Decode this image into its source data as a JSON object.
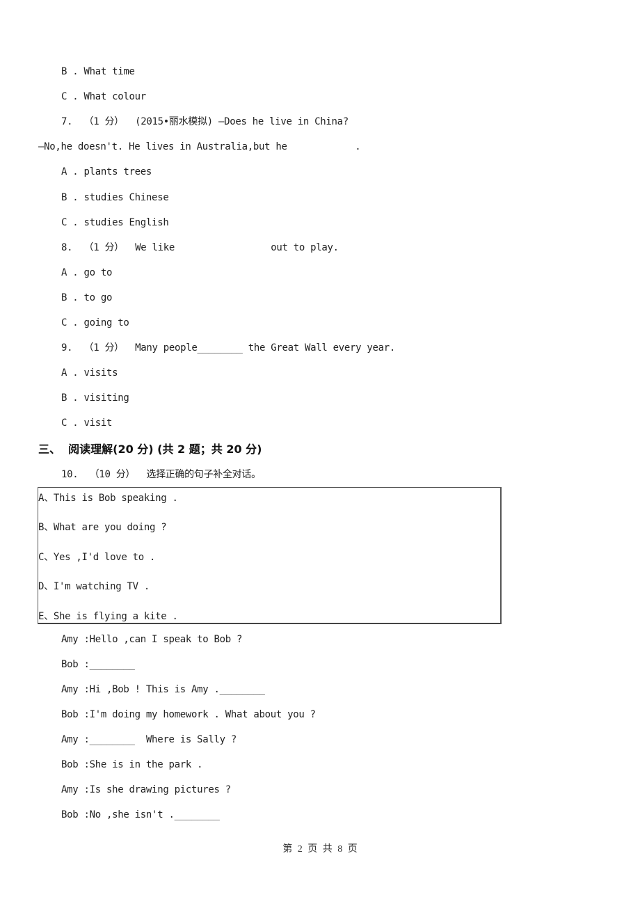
{
  "page": {
    "lines": [
      {
        "id": "q6-option-b",
        "text": "B . What time"
      },
      {
        "id": "q6-option-c",
        "text": "C . What colour"
      },
      {
        "id": "q7-stem",
        "text": "7.  （1 分）  (2015•丽水模拟) —Does he live in China?"
      },
      {
        "id": "q7-stem-2",
        "text": "—No,he doesn't. He lives in Australia,but he            ."
      },
      {
        "id": "q7-option-a",
        "text": "A . plants trees"
      },
      {
        "id": "q7-option-b",
        "text": "B . studies Chinese"
      },
      {
        "id": "q7-option-c",
        "text": "C . studies English"
      },
      {
        "id": "q8-stem",
        "text": "8.  （1 分）  We like                 out to play."
      },
      {
        "id": "q8-option-a",
        "text": "A . go to"
      },
      {
        "id": "q8-option-b",
        "text": "B . to go"
      },
      {
        "id": "q8-option-c",
        "text": "C . going to"
      },
      {
        "id": "q9-stem",
        "text": "9.  （1 分）  Many people________ the Great Wall every year."
      },
      {
        "id": "q9-option-a",
        "text": "A . visits"
      },
      {
        "id": "q9-option-b",
        "text": "B . visiting"
      },
      {
        "id": "q9-option-c",
        "text": "C . visit"
      }
    ],
    "section_heading": "三、  阅读理解(20 分) (共 2 题；共 20 分)",
    "q10_stem": "10.  （10 分）  选择正确的句子补全对话。",
    "q10_options": [
      "A、This is Bob speaking .",
      "B、What are you doing ?",
      "C、Yes ,I'd love to .",
      "D、I'm watching TV .",
      "E、She is flying a kite ."
    ],
    "dialogue": [
      "Amy :Hello ,can I speak to Bob ?",
      "Bob :________",
      "Amy :Hi ,Bob ! This is Amy .________",
      "Bob :I'm doing my homework . What about you ?",
      "Amy :________  Where is Sally ?",
      "Bob :She is in the park .",
      "Amy :Is she drawing pictures ?",
      "Bob :No ,she isn't .________"
    ],
    "footer": "第 2 页 共 8 页"
  }
}
